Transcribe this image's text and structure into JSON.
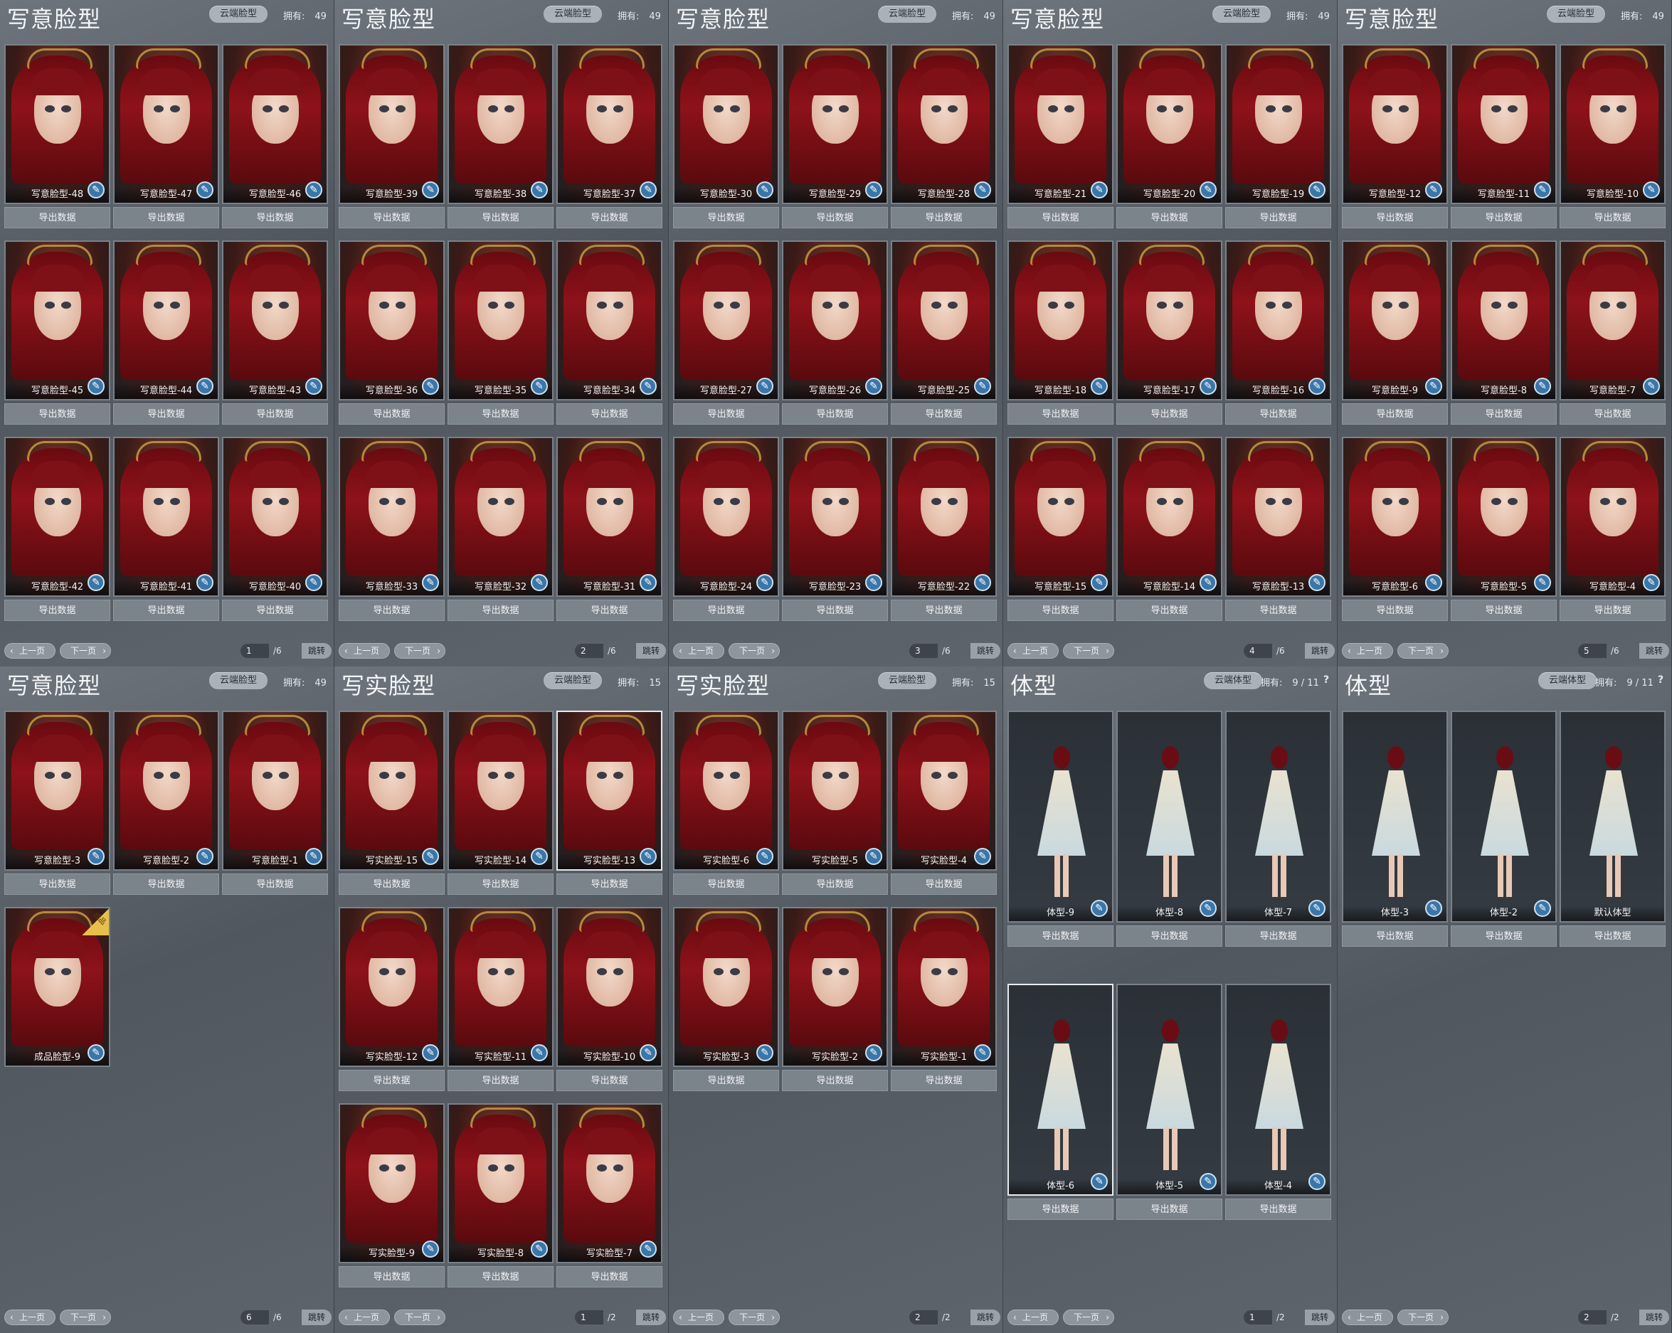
{
  "labels": {
    "cloud_face": "云端脸型",
    "cloud_body": "云端体型",
    "owned": "拥有:",
    "export": "导出数据",
    "prev": "上一页",
    "next": "下一页",
    "jump": "跳转",
    "badge": "成品"
  },
  "icons": {
    "brush": "brush-icon",
    "prev": "chevron-left-icon",
    "next": "chevron-right-icon",
    "help": "question-icon"
  },
  "panels": [
    {
      "title": "写意脸型",
      "cloud": "云端脸型",
      "owned": "49",
      "type": "face",
      "page": "1",
      "total": "/6",
      "cards": [
        {
          "name": "写意脸型-48"
        },
        {
          "name": "写意脸型-47"
        },
        {
          "name": "写意脸型-46"
        },
        {
          "name": "写意脸型-45"
        },
        {
          "name": "写意脸型-44"
        },
        {
          "name": "写意脸型-43"
        },
        {
          "name": "写意脸型-42"
        },
        {
          "name": "写意脸型-41"
        },
        {
          "name": "写意脸型-40"
        }
      ]
    },
    {
      "title": "写意脸型",
      "cloud": "云端脸型",
      "owned": "49",
      "type": "face",
      "page": "2",
      "total": "/6",
      "cards": [
        {
          "name": "写意脸型-39"
        },
        {
          "name": "写意脸型-38"
        },
        {
          "name": "写意脸型-37"
        },
        {
          "name": "写意脸型-36"
        },
        {
          "name": "写意脸型-35"
        },
        {
          "name": "写意脸型-34"
        },
        {
          "name": "写意脸型-33"
        },
        {
          "name": "写意脸型-32"
        },
        {
          "name": "写意脸型-31"
        }
      ]
    },
    {
      "title": "写意脸型",
      "cloud": "云端脸型",
      "owned": "49",
      "type": "face",
      "page": "3",
      "total": "/6",
      "cards": [
        {
          "name": "写意脸型-30"
        },
        {
          "name": "写意脸型-29"
        },
        {
          "name": "写意脸型-28"
        },
        {
          "name": "写意脸型-27"
        },
        {
          "name": "写意脸型-26"
        },
        {
          "name": "写意脸型-25"
        },
        {
          "name": "写意脸型-24"
        },
        {
          "name": "写意脸型-23"
        },
        {
          "name": "写意脸型-22"
        }
      ]
    },
    {
      "title": "写意脸型",
      "cloud": "云端脸型",
      "owned": "49",
      "type": "face",
      "page": "4",
      "total": "/6",
      "cards": [
        {
          "name": "写意脸型-21"
        },
        {
          "name": "写意脸型-20"
        },
        {
          "name": "写意脸型-19"
        },
        {
          "name": "写意脸型-18"
        },
        {
          "name": "写意脸型-17"
        },
        {
          "name": "写意脸型-16"
        },
        {
          "name": "写意脸型-15"
        },
        {
          "name": "写意脸型-14"
        },
        {
          "name": "写意脸型-13"
        }
      ]
    },
    {
      "title": "写意脸型",
      "cloud": "云端脸型",
      "owned": "49",
      "type": "face",
      "page": "5",
      "total": "/6",
      "cards": [
        {
          "name": "写意脸型-12"
        },
        {
          "name": "写意脸型-11"
        },
        {
          "name": "写意脸型-10"
        },
        {
          "name": "写意脸型-9"
        },
        {
          "name": "写意脸型-8"
        },
        {
          "name": "写意脸型-7"
        },
        {
          "name": "写意脸型-6"
        },
        {
          "name": "写意脸型-5"
        },
        {
          "name": "写意脸型-4"
        }
      ]
    },
    {
      "title": "写意脸型",
      "cloud": "云端脸型",
      "owned": "49",
      "type": "face",
      "page": "6",
      "total": "/6",
      "cards": [
        {
          "name": "写意脸型-3",
          "export": true
        },
        {
          "name": "写意脸型-2",
          "export": true
        },
        {
          "name": "写意脸型-1",
          "export": true
        },
        {
          "name": "成品脸型-9",
          "export": false,
          "badge": true
        }
      ]
    },
    {
      "title": "写实脸型",
      "cloud": "云端脸型",
      "owned": "15",
      "type": "face",
      "page": "1",
      "total": "/2",
      "cards": [
        {
          "name": "写实脸型-15"
        },
        {
          "name": "写实脸型-14"
        },
        {
          "name": "写实脸型-13",
          "selected": true
        },
        {
          "name": "写实脸型-12"
        },
        {
          "name": "写实脸型-11"
        },
        {
          "name": "写实脸型-10"
        },
        {
          "name": "写实脸型-9"
        },
        {
          "name": "写实脸型-8"
        },
        {
          "name": "写实脸型-7"
        }
      ]
    },
    {
      "title": "写实脸型",
      "cloud": "云端脸型",
      "owned": "15",
      "type": "face",
      "page": "2",
      "total": "/2",
      "cards": [
        {
          "name": "写实脸型-6"
        },
        {
          "name": "写实脸型-5"
        },
        {
          "name": "写实脸型-4"
        },
        {
          "name": "写实脸型-3"
        },
        {
          "name": "写实脸型-2"
        },
        {
          "name": "写实脸型-1"
        }
      ]
    },
    {
      "title": "体型",
      "cloud": "云端体型",
      "owned": "9 / 11",
      "help": "?",
      "type": "body",
      "page": "1",
      "total": "/2",
      "cards": [
        {
          "name": "体型-9"
        },
        {
          "name": "体型-8"
        },
        {
          "name": "体型-7"
        },
        {
          "name": "体型-6",
          "selected": true
        },
        {
          "name": "体型-5"
        },
        {
          "name": "体型-4"
        }
      ]
    },
    {
      "title": "体型",
      "cloud": "云端体型",
      "owned": "9 / 11",
      "help": "?",
      "type": "body",
      "page": "2",
      "total": "/2",
      "cards": [
        {
          "name": "体型-3"
        },
        {
          "name": "体型-2"
        },
        {
          "name": "默认体型",
          "brush": false
        }
      ]
    }
  ]
}
